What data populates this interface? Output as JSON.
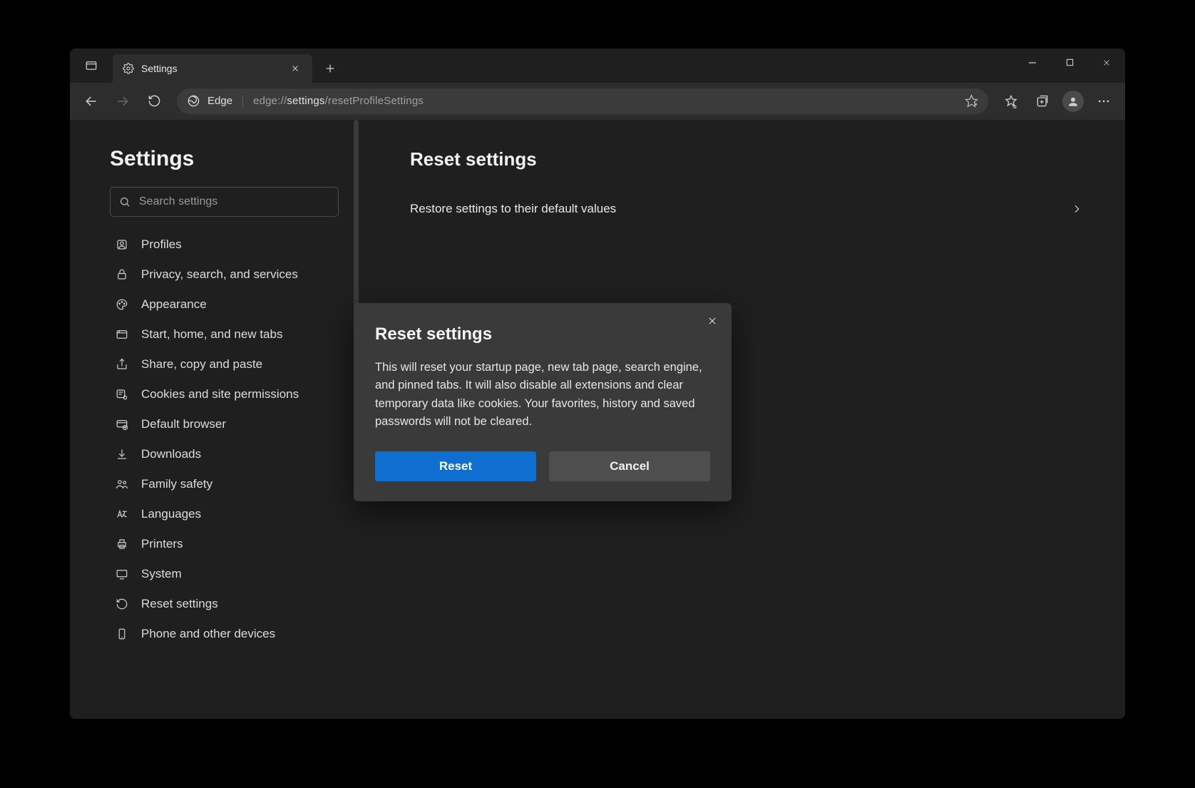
{
  "tab": {
    "title": "Settings"
  },
  "toolbar": {
    "edge_label": "Edge",
    "url_prefix": "edge://",
    "url_strong": "settings",
    "url_suffix": "/resetProfileSettings"
  },
  "sidebar": {
    "title": "Settings",
    "search_placeholder": "Search settings",
    "items": [
      {
        "label": "Profiles"
      },
      {
        "label": "Privacy, search, and services"
      },
      {
        "label": "Appearance"
      },
      {
        "label": "Start, home, and new tabs"
      },
      {
        "label": "Share, copy and paste"
      },
      {
        "label": "Cookies and site permissions"
      },
      {
        "label": "Default browser"
      },
      {
        "label": "Downloads"
      },
      {
        "label": "Family safety"
      },
      {
        "label": "Languages"
      },
      {
        "label": "Printers"
      },
      {
        "label": "System"
      },
      {
        "label": "Reset settings"
      },
      {
        "label": "Phone and other devices"
      }
    ]
  },
  "main": {
    "heading": "Reset settings",
    "row_label": "Restore settings to their default values"
  },
  "dialog": {
    "title": "Reset settings",
    "body": "This will reset your startup page, new tab page, search engine, and pinned tabs. It will also disable all extensions and clear temporary data like cookies. Your favorites, history and saved passwords will not be cleared.",
    "primary": "Reset",
    "secondary": "Cancel"
  }
}
